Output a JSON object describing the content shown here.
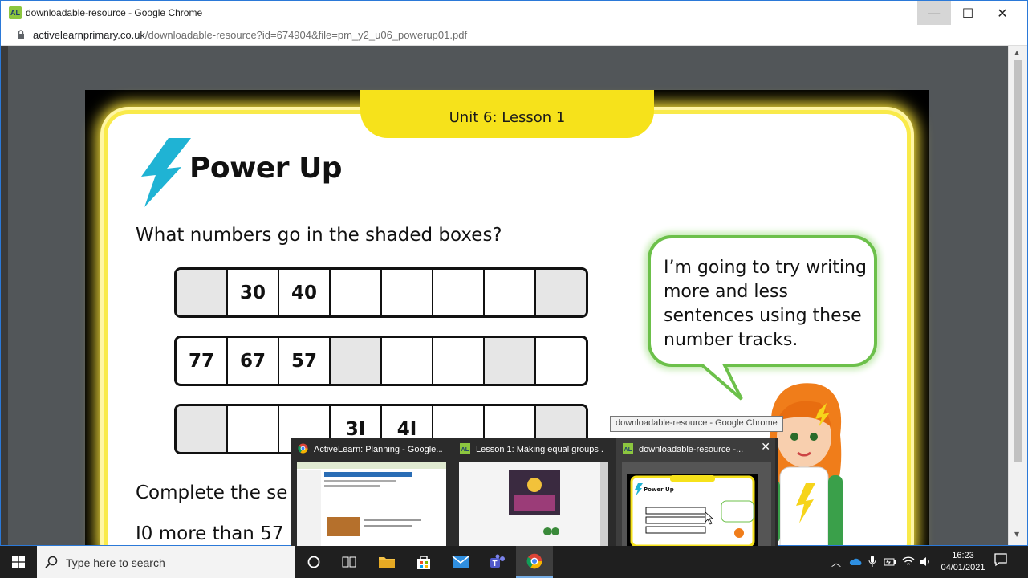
{
  "window": {
    "title": "downloadable-resource - Google Chrome",
    "app_icon_text": "AL",
    "minimize": "—",
    "maximize": "☐",
    "close": "✕"
  },
  "address_bar": {
    "domain": "activelearnprimary.co.uk",
    "path": "/downloadable-resource?id=674904&file=pm_y2_u06_powerup01.pdf"
  },
  "document": {
    "tab_label": "Unit 6: Lesson 1",
    "heading": "Power Up",
    "question": "What numbers go in the shaded boxes?",
    "tracks": [
      {
        "cells": [
          {
            "v": "",
            "shaded": true
          },
          {
            "v": "30"
          },
          {
            "v": "40"
          },
          {
            "v": ""
          },
          {
            "v": ""
          },
          {
            "v": ""
          },
          {
            "v": ""
          },
          {
            "v": "",
            "shaded": true
          }
        ]
      },
      {
        "cells": [
          {
            "v": "77"
          },
          {
            "v": "67"
          },
          {
            "v": "57"
          },
          {
            "v": "",
            "shaded": true
          },
          {
            "v": ""
          },
          {
            "v": ""
          },
          {
            "v": "",
            "shaded": true
          },
          {
            "v": ""
          }
        ]
      },
      {
        "cells": [
          {
            "v": "",
            "shaded": true
          },
          {
            "v": ""
          },
          {
            "v": ""
          },
          {
            "v": "3I"
          },
          {
            "v": "4I"
          },
          {
            "v": ""
          },
          {
            "v": ""
          },
          {
            "v": "",
            "shaded": true
          }
        ]
      }
    ],
    "complete_text": "Complete the se",
    "more_text": "I0 more than 57",
    "speech_bubble": "I’m going to try writing more and less sentences using these number tracks."
  },
  "tooltip": "downloadable-resource - Google Chrome",
  "thumbnails": [
    {
      "title": "ActiveLearn: Planning - Google...",
      "icon": "chrome-icon",
      "active": false
    },
    {
      "title": "Lesson 1: Making equal groups ...",
      "icon": "al-icon",
      "active": false
    },
    {
      "title": "downloadable-resource -...",
      "icon": "al-icon",
      "active": true
    }
  ],
  "thumbnail_close": "✕",
  "thumbnail_previews": {
    "heading": "Power Up"
  },
  "taskbar": {
    "search_placeholder": "Type here to search",
    "time": "16:23",
    "date": "04/01/2021"
  },
  "colors": {
    "accent_yellow": "#f6e21b",
    "bolt_cyan": "#1fb3d4",
    "bubble_green": "#6cc04a",
    "window_border": "#2b79d8"
  }
}
